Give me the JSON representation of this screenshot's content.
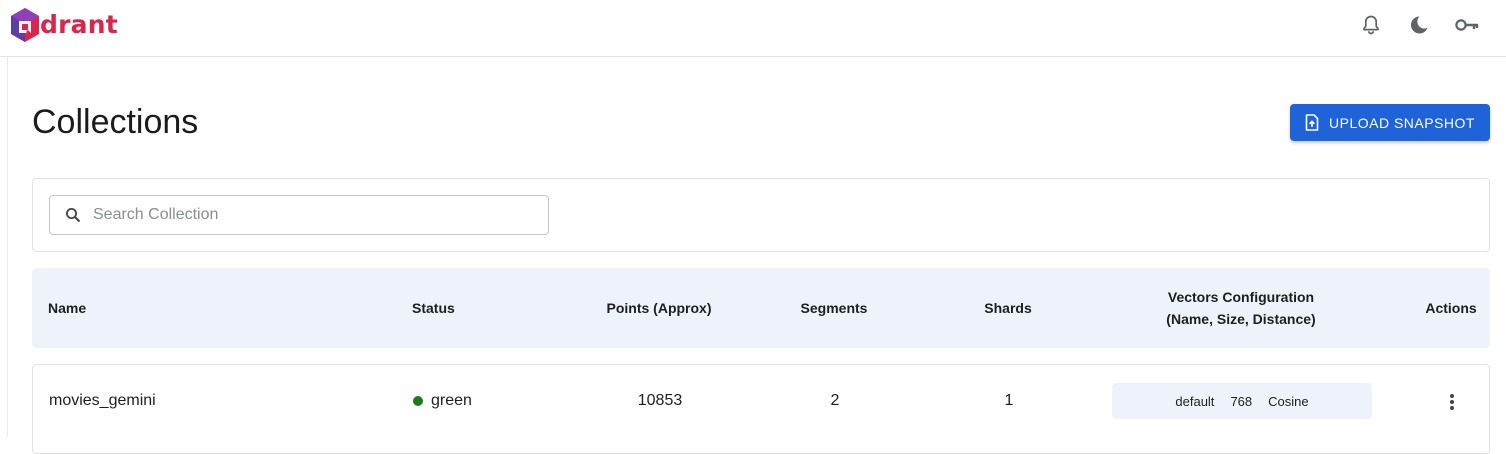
{
  "header": {
    "logo_text": "drant",
    "icons": [
      "bell-icon",
      "dark-mode-icon",
      "key-icon"
    ]
  },
  "page": {
    "title": "Collections",
    "upload_label": "UPLOAD SNAPSHOT"
  },
  "search": {
    "placeholder": "Search Collection",
    "value": ""
  },
  "table": {
    "columns": {
      "name": "Name",
      "status": "Status",
      "points": "Points (Approx)",
      "segments": "Segments",
      "shards": "Shards",
      "vectors_line1": "Vectors Configuration",
      "vectors_line2": "(Name, Size, Distance)",
      "actions": "Actions"
    },
    "rows": [
      {
        "name": "movies_gemini",
        "status": "green",
        "points": "10853",
        "segments": "2",
        "shards": "1",
        "vector_name": "default",
        "vector_size": "768",
        "vector_distance": "Cosine"
      }
    ]
  },
  "colors": {
    "brand": "#dc244c",
    "accent": "#1e63d8",
    "status_green": "#1f7a1f",
    "header_bg": "#eef3fb"
  }
}
